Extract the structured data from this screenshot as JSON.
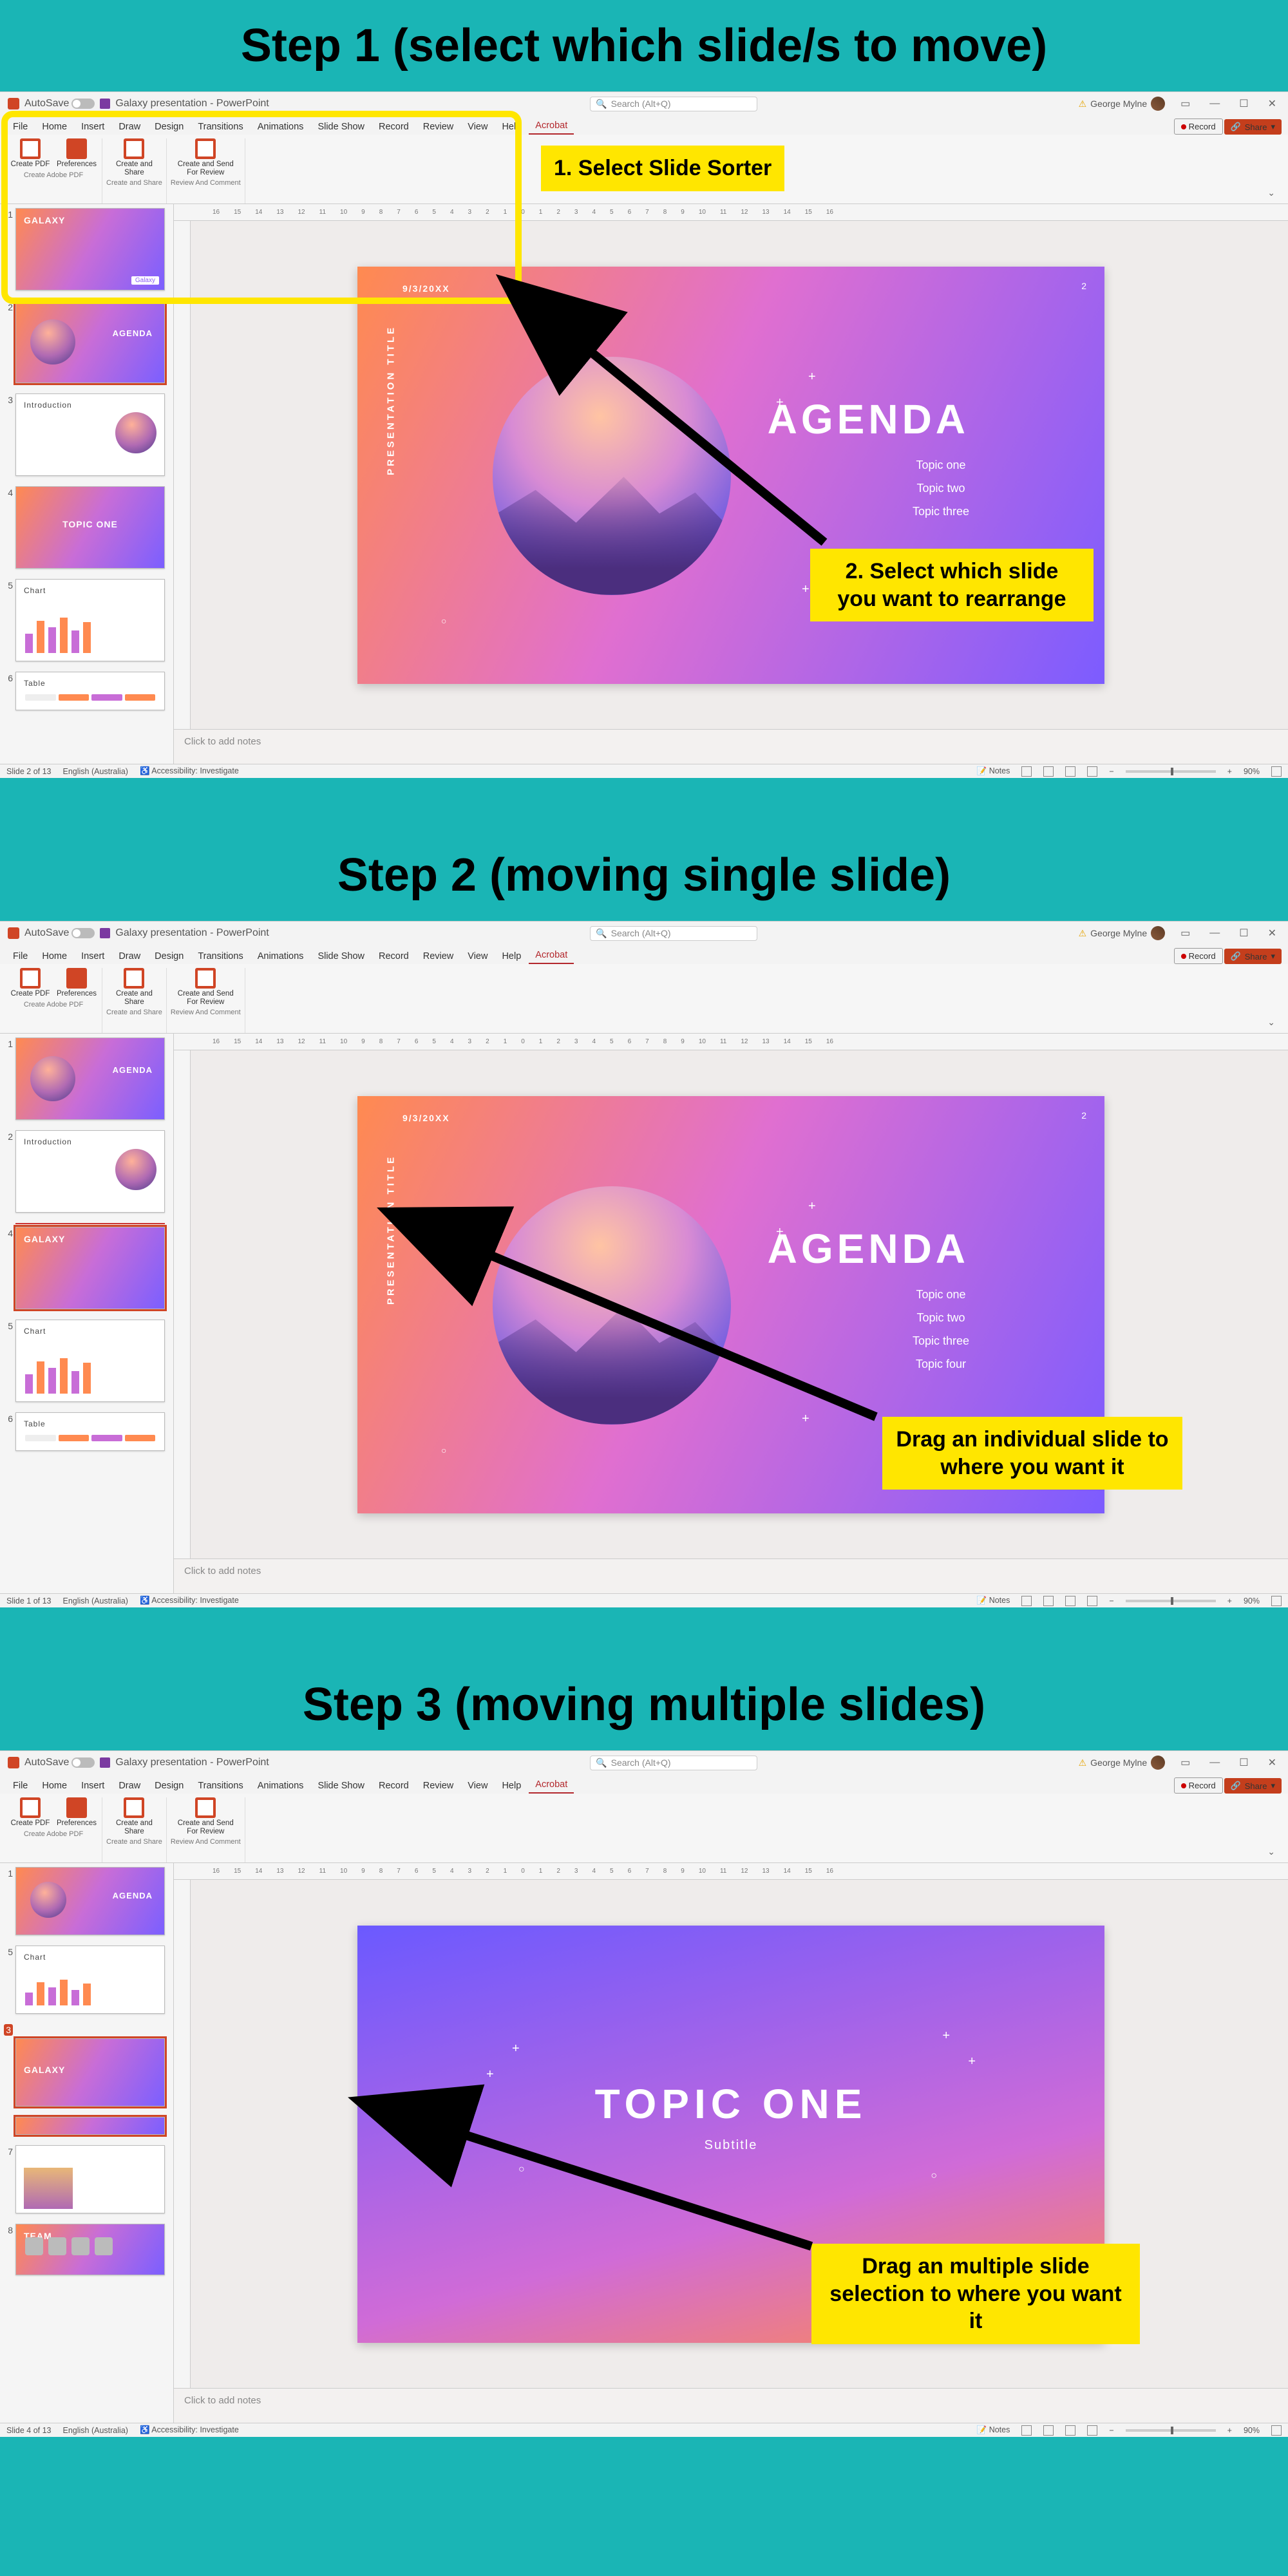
{
  "steps": {
    "s1": "Step 1 (select which slide/s to move)",
    "s2": "Step 2 (moving single slide)",
    "s3": "Step 3 (moving multiple slides)"
  },
  "callouts": {
    "c1a": "1.   Select Slide Sorter",
    "c1b": "2. Select which slide you want to rearrange",
    "c2": "Drag an individual slide to where you want it",
    "c3": "Drag an multiple slide selection to where you want it"
  },
  "titlebar": {
    "autosave": "AutoSave",
    "doc": "Galaxy presentation - PowerPoint",
    "search_ph": "Search (Alt+Q)",
    "user": "George Mylne"
  },
  "menu": {
    "tabs": [
      "File",
      "Home",
      "Insert",
      "Draw",
      "Design",
      "Transitions",
      "Animations",
      "Slide Show",
      "Record",
      "Review",
      "View",
      "Help",
      "Acrobat"
    ],
    "record": "Record",
    "share": "Share"
  },
  "ribbon": {
    "g1a": "Create PDF",
    "g1b": "Preferences",
    "g2": "Create and Share",
    "g3": "Create and Send For Review",
    "cap1": "Create Adobe PDF",
    "cap2": "Create and Share",
    "cap3": "Review And Comment"
  },
  "ruler": [
    "16",
    "15",
    "14",
    "13",
    "12",
    "11",
    "10",
    "9",
    "8",
    "7",
    "6",
    "5",
    "4",
    "3",
    "2",
    "1",
    "0",
    "1",
    "2",
    "3",
    "4",
    "5",
    "6",
    "7",
    "8",
    "9",
    "10",
    "11",
    "12",
    "13",
    "14",
    "15",
    "16"
  ],
  "thumbs": {
    "galaxy": "GALAXY",
    "agenda": "AGENDA",
    "intro": "Introduction",
    "topic": "TOPIC ONE",
    "chart": "Chart",
    "table": "Table",
    "team": "TEAM",
    "tag": "Galaxy"
  },
  "slide": {
    "date": "9/3/20XX",
    "pnum": "2",
    "vtitle": "PRESENTATION TITLE",
    "heading": "AGENDA",
    "topics3": "Topic one\nTopic two\nTopic three",
    "topics4": "Topic one\nTopic two\nTopic three\nTopic four",
    "topic_heading": "TOPIC ONE",
    "sub": "Subtitle"
  },
  "notes": "Click to add notes",
  "status": {
    "s1_slide": "Slide 2 of 13",
    "s2_slide": "Slide 1 of 13",
    "s3_slide": "Slide 4 of 13",
    "lang": "English (Australia)",
    "acc": "Accessibility: Investigate",
    "notes": "Notes",
    "zoom": "90%"
  }
}
